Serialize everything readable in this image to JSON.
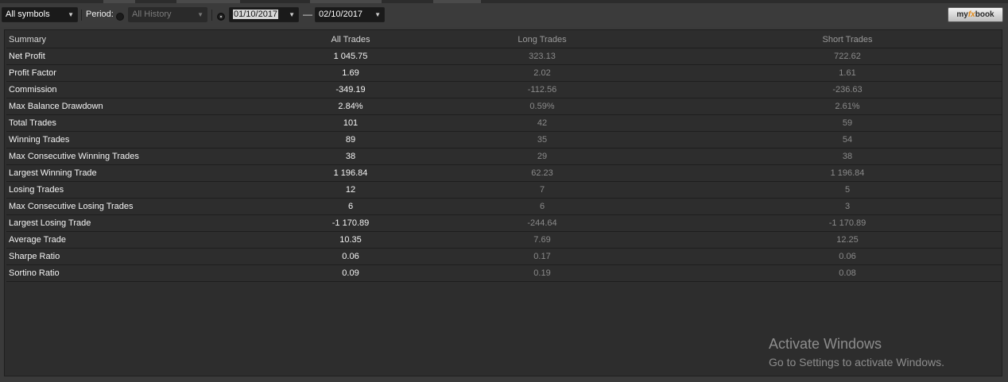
{
  "toolbar": {
    "symbol_filter": "All symbols",
    "period_label": "Period:",
    "history_option": "All History",
    "date_from": "01/10/2017",
    "date_separator": "—",
    "date_to": "02/10/2017",
    "brand_prefix": "my",
    "brand_fx": "fx",
    "brand_suffix": "book"
  },
  "table": {
    "headers": [
      "Summary",
      "All Trades",
      "Long Trades",
      "Short Trades"
    ],
    "rows": [
      {
        "label": "Net Profit",
        "all": "1 045.75",
        "long": "323.13",
        "short": "722.62"
      },
      {
        "label": "Profit Factor",
        "all": "1.69",
        "long": "2.02",
        "short": "1.61"
      },
      {
        "label": "Commission",
        "all": "-349.19",
        "long": "-112.56",
        "short": "-236.63"
      },
      {
        "label": "Max Balance Drawdown",
        "all": "2.84%",
        "long": "0.59%",
        "short": "2.61%"
      },
      {
        "label": "Total Trades",
        "all": "101",
        "long": "42",
        "short": "59"
      },
      {
        "label": "Winning Trades",
        "all": "89",
        "long": "35",
        "short": "54"
      },
      {
        "label": "Max Consecutive Winning Trades",
        "all": "38",
        "long": "29",
        "short": "38"
      },
      {
        "label": "Largest Winning Trade",
        "all": "1 196.84",
        "long": "62.23",
        "short": "1 196.84"
      },
      {
        "label": "Losing Trades",
        "all": "12",
        "long": "7",
        "short": "5"
      },
      {
        "label": "Max Consecutive Losing Trades",
        "all": "6",
        "long": "6",
        "short": "3"
      },
      {
        "label": "Largest Losing Trade",
        "all": "-1 170.89",
        "long": "-244.64",
        "short": "-1 170.89"
      },
      {
        "label": "Average Trade",
        "all": "10.35",
        "long": "7.69",
        "short": "12.25"
      },
      {
        "label": "Sharpe Ratio",
        "all": "0.06",
        "long": "0.17",
        "short": "0.06"
      },
      {
        "label": "Sortino Ratio",
        "all": "0.09",
        "long": "0.19",
        "short": "0.08"
      }
    ]
  },
  "watermark": {
    "title": "Activate Windows",
    "subtitle": "Go to Settings to activate Windows."
  },
  "icons": {
    "dropdown": "chevron-down-icon",
    "radio": "radio-icon"
  }
}
